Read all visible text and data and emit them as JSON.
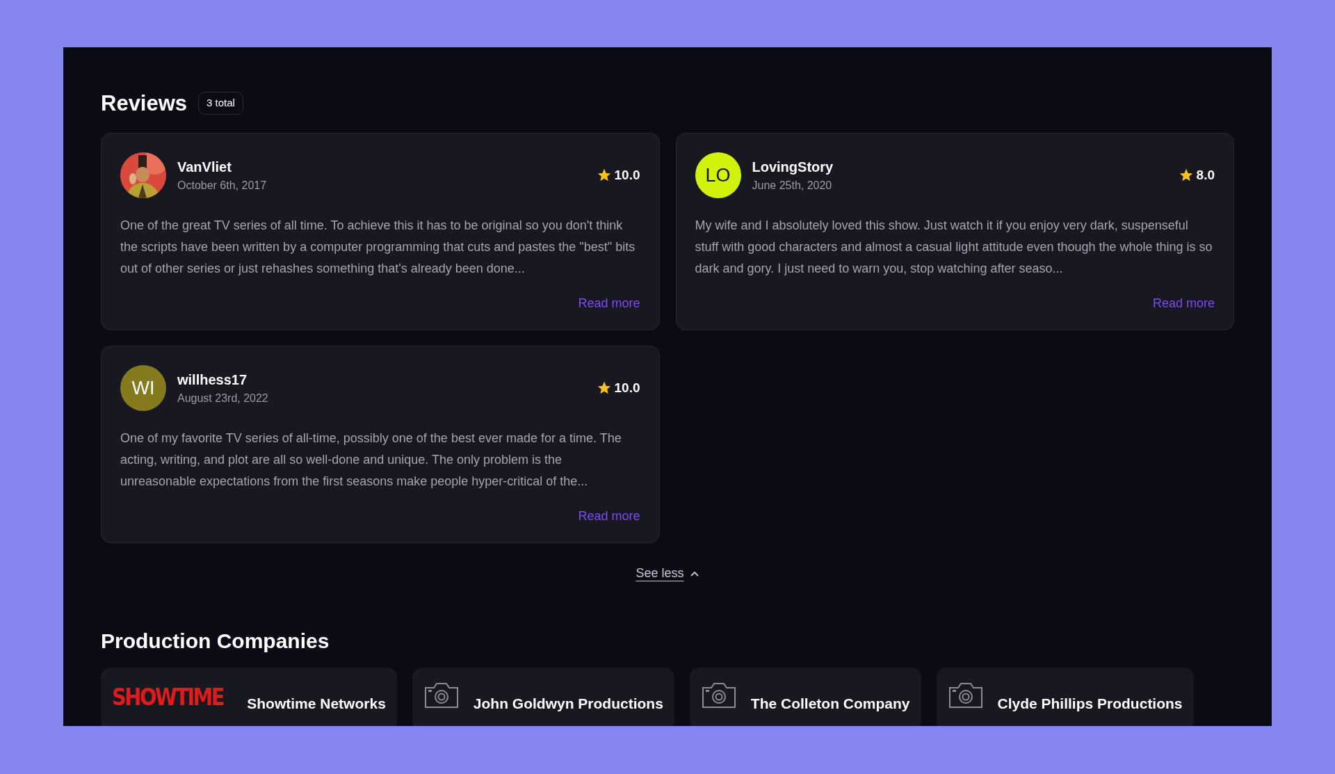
{
  "reviews": {
    "title": "Reviews",
    "count": "3 total",
    "items": [
      {
        "author": "VanVliet",
        "date": "October 6th, 2017",
        "rating": "10.0",
        "text": "One of the great TV series of all time. To achieve this it has to be original so you don't think the scripts have been written by a computer programming that cuts and pastes the \"best\" bits out of other series or just rehashes something that's already been done...",
        "link": "Read more"
      },
      {
        "author": "LovingStory",
        "date": "June 25th, 2020",
        "rating": "8.0",
        "avatar": {
          "kind": "initials",
          "initials": "LO",
          "color": "#d2f20c"
        },
        "text": "My wife and I absolutely loved this show. Just watch it if you enjoy very dark, suspenseful stuff with good characters and almost a casual light attitude even though the whole thing is so dark and gory. I just need to warn you, stop watching after seaso...",
        "link": "Read more"
      },
      {
        "author": "willhess17",
        "date": "August 23rd, 2022",
        "rating": "10.0",
        "avatar": {
          "kind": "initials",
          "initials": "WI",
          "color": "#857b1e"
        },
        "text": "One of my favorite TV series of all-time, possibly one of the best ever made for a time. The acting, writing, and plot are all so well-done and unique. The only problem is the unreasonable expectations from the first seasons make people hyper-critical of the...",
        "link": "Read more"
      }
    ],
    "toggle": "See less"
  },
  "production_companies": {
    "title": "Production Companies",
    "items": [
      {
        "kind": "logo",
        "logo_text": "SHOWTIME",
        "name": "Showtime Networks"
      },
      {
        "kind": "placeholder",
        "name": "John Goldwyn Productions"
      },
      {
        "kind": "placeholder",
        "name": "The Colleton Company"
      },
      {
        "kind": "placeholder",
        "name": "Clyde Phillips Productions"
      }
    ]
  }
}
